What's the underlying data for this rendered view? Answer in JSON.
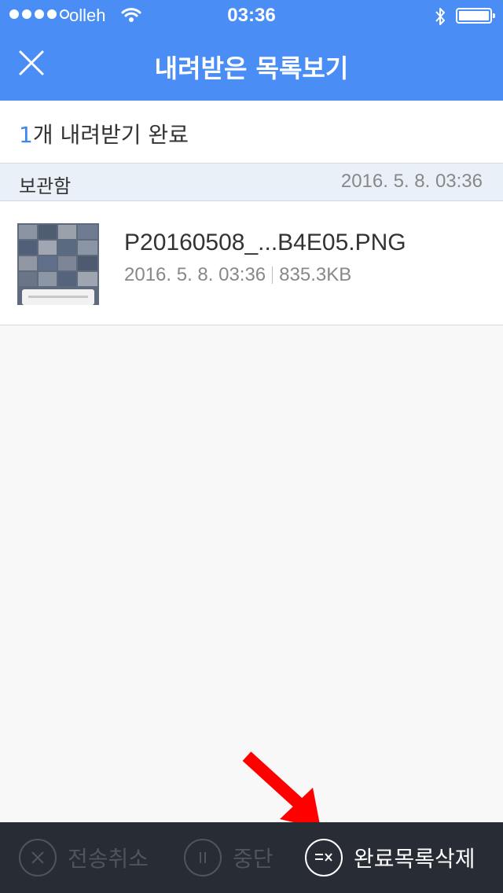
{
  "status_bar": {
    "carrier": "olleh",
    "time": "03:36",
    "signal_icon": "signal-dots-icon",
    "wifi_icon": "wifi-icon",
    "bluetooth_icon": "bluetooth-icon",
    "battery_icon": "battery-icon"
  },
  "header": {
    "title": "내려받은 목록보기",
    "close_icon": "close-icon",
    "background": "#4a8ef5"
  },
  "summary": {
    "count": "1",
    "text": "개 내려받기 완료",
    "count_color": "#3d86f0"
  },
  "section": {
    "label": "보관함",
    "date": "2016. 5. 8. 03:36"
  },
  "files": [
    {
      "name": "P20160508_...B4E05.PNG",
      "date": "2016. 5. 8. 03:36",
      "size": "835.3KB"
    }
  ],
  "bottom_bar": {
    "cancel_label": "전송취소",
    "pause_label": "중단",
    "clear_label": "완료목록삭제",
    "background": "#282c34"
  },
  "annotation": {
    "arrow_color": "#ff0000"
  }
}
